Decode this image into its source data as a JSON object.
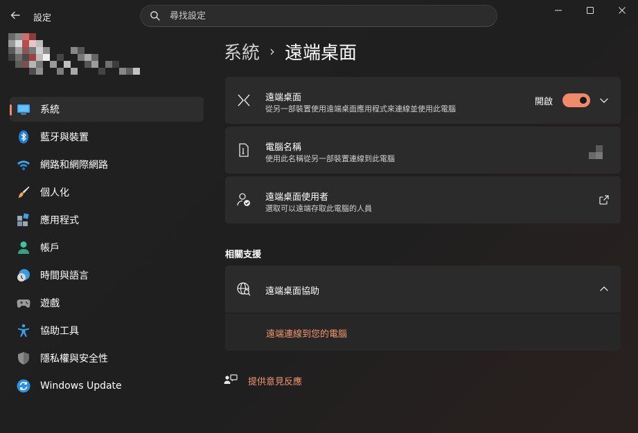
{
  "app": {
    "title": "設定"
  },
  "search": {
    "placeholder": "尋找設定"
  },
  "sidebar": {
    "items": [
      {
        "label": "系統",
        "icon": "monitor-icon",
        "active": true
      },
      {
        "label": "藍牙與裝置",
        "icon": "bluetooth-icon"
      },
      {
        "label": "網路和網際網路",
        "icon": "wifi-icon"
      },
      {
        "label": "個人化",
        "icon": "paintbrush-icon"
      },
      {
        "label": "應用程式",
        "icon": "apps-icon"
      },
      {
        "label": "帳戶",
        "icon": "person-icon"
      },
      {
        "label": "時間與語言",
        "icon": "clock-globe-icon"
      },
      {
        "label": "遊戲",
        "icon": "gamepad-icon"
      },
      {
        "label": "協助工具",
        "icon": "accessibility-icon"
      },
      {
        "label": "隱私權與安全性",
        "icon": "shield-icon"
      },
      {
        "label": "Windows Update",
        "icon": "update-icon"
      }
    ]
  },
  "breadcrumb": {
    "parent": "系統",
    "current": "遠端桌面"
  },
  "cards": {
    "remote_desktop": {
      "title": "遠端桌面",
      "subtitle": "從另一部裝置使用遠端桌面應用程式來連線並使用此電腦",
      "toggle_label": "開啟",
      "toggle_on": true
    },
    "pc_name": {
      "title": "電腦名稱",
      "subtitle": "使用此名稱從另一部裝置連線到此電腦"
    },
    "users": {
      "title": "遠端桌面使用者",
      "subtitle": "選取可以遠端存取此電腦的人員"
    }
  },
  "related": {
    "section_title": "相關支援",
    "help_title": "遠端桌面協助",
    "link": "遠端連線到您的電腦"
  },
  "feedback": {
    "label": "提供意見反應"
  },
  "colors": {
    "accent": "#f08a6b",
    "link": "#f2966f",
    "card": "#2b2b2b",
    "background": "#202020"
  }
}
